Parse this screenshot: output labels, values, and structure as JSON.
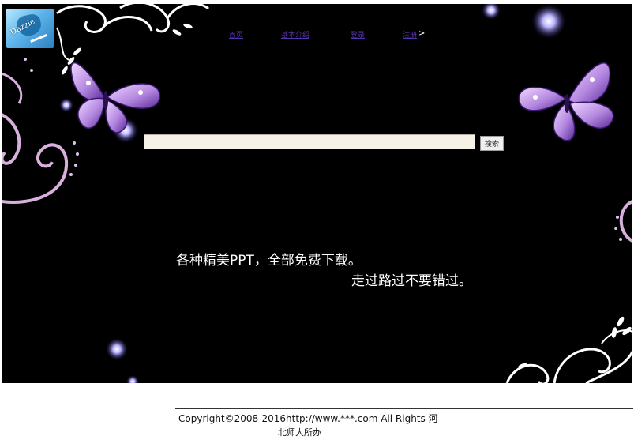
{
  "header": {
    "logo_text": "Dazzle"
  },
  "nav": {
    "items": [
      {
        "label": "首页"
      },
      {
        "label": "基本介绍"
      },
      {
        "label": "登录"
      },
      {
        "label": "注册"
      }
    ],
    "trailing": ">"
  },
  "search": {
    "placeholder": "",
    "value": "",
    "button_label": "搜索"
  },
  "tagline": {
    "line1": "各种精美PPT，全部免费下载。",
    "line2": "走过路过不要错过。"
  },
  "footer": {
    "line1": "Copyright©2008-2016http://www.***.com All Rights 河",
    "line2": "北师大所办"
  },
  "colors": {
    "background": "#000000",
    "nav_link": "#5533aa",
    "search_field": "#f6f1e6",
    "butterfly": "#c9a0e8",
    "swirl": "#ffffff"
  }
}
